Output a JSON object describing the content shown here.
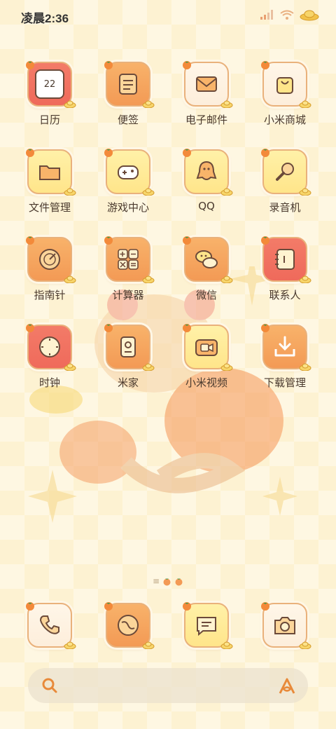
{
  "status_bar": {
    "time": "凌晨2:36"
  },
  "apps": [
    {
      "label": "日历",
      "icon": "calendar-icon",
      "color": "red",
      "glyph": "22"
    },
    {
      "label": "便签",
      "icon": "notes-icon",
      "color": "orange"
    },
    {
      "label": "电子邮件",
      "icon": "mail-icon",
      "color": "cream"
    },
    {
      "label": "小米商城",
      "icon": "shopping-bag-icon",
      "color": "cream"
    },
    {
      "label": "文件管理",
      "icon": "folder-icon",
      "color": "yellow"
    },
    {
      "label": "游戏中心",
      "icon": "gamepad-icon",
      "color": "yellow"
    },
    {
      "label": "QQ",
      "icon": "qq-penguin-icon",
      "color": "yellow"
    },
    {
      "label": "录音机",
      "icon": "microphone-icon",
      "color": "yellow"
    },
    {
      "label": "指南针",
      "icon": "compass-icon",
      "color": "orange"
    },
    {
      "label": "计算器",
      "icon": "calculator-icon",
      "color": "orange"
    },
    {
      "label": "微信",
      "icon": "wechat-icon",
      "color": "orange"
    },
    {
      "label": "联系人",
      "icon": "contacts-icon",
      "color": "red"
    },
    {
      "label": "时钟",
      "icon": "clock-icon",
      "color": "red"
    },
    {
      "label": "米家",
      "icon": "mijia-icon",
      "color": "orange"
    },
    {
      "label": "小米视频",
      "icon": "video-camera-icon",
      "color": "yellow"
    },
    {
      "label": "下载管理",
      "icon": "download-icon",
      "color": "orange"
    }
  ],
  "dock": [
    {
      "icon": "phone-icon",
      "color": "cream"
    },
    {
      "icon": "browser-icon",
      "color": "orange"
    },
    {
      "icon": "message-icon",
      "color": "yellow"
    },
    {
      "icon": "camera-icon",
      "color": "cream"
    }
  ],
  "page_indicator": {
    "pages": 2,
    "active": 0
  },
  "search": {
    "left_icon": "search-icon",
    "right_icon": "xiaoai-assistant-icon"
  },
  "colors": {
    "accent": "#e88a3a",
    "text": "#4a3a2e",
    "background": "#fdf2d2"
  }
}
